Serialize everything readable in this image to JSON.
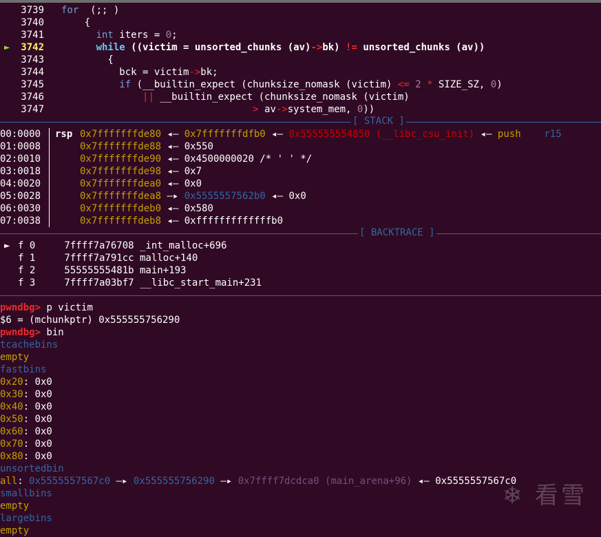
{
  "source": {
    "lines": [
      {
        "num": "3739",
        "parts": [
          [
            "kw",
            "for"
          ],
          [
            "",
            "  (;; )"
          ]
        ]
      },
      {
        "num": "3740",
        "parts": [
          [
            "",
            "    {"
          ]
        ]
      },
      {
        "num": "3741",
        "parts": [
          [
            "",
            "      "
          ],
          [
            "kw",
            "int"
          ],
          [
            "",
            " iters = "
          ],
          [
            "num",
            "0"
          ],
          [
            "",
            ";"
          ]
        ]
      },
      {
        "num": "3742",
        "parts": [
          [
            "",
            "      "
          ],
          [
            "cyanish",
            "while"
          ],
          [
            "",
            " ((victim = unsorted_chunks (av)"
          ],
          [
            "op",
            "->"
          ],
          [
            "",
            "bk) "
          ],
          [
            "op",
            "!="
          ],
          [
            "",
            " unsorted_chunks (av))"
          ]
        ]
      },
      {
        "num": "3743",
        "parts": [
          [
            "",
            "        {"
          ]
        ]
      },
      {
        "num": "3744",
        "parts": [
          [
            "",
            "          bck = victim"
          ],
          [
            "op",
            "->"
          ],
          [
            "",
            "bk;"
          ]
        ]
      },
      {
        "num": "3745",
        "parts": [
          [
            "",
            "          "
          ],
          [
            "kw",
            "if"
          ],
          [
            "",
            " (__builtin_expect (chunksize_nomask (victim) "
          ],
          [
            "op",
            "<="
          ],
          [
            "",
            " "
          ],
          [
            "num",
            "2"
          ],
          [
            "",
            " "
          ],
          [
            "op",
            "*"
          ],
          [
            "",
            " SIZE_SZ, "
          ],
          [
            "num",
            "0"
          ],
          [
            "",
            ")"
          ]
        ]
      },
      {
        "num": "3746",
        "parts": [
          [
            "",
            "              "
          ],
          [
            "op",
            "||"
          ],
          [
            "",
            " __builtin_expect (chunksize_nomask (victim)"
          ]
        ]
      },
      {
        "num": "3747",
        "parts": [
          [
            "",
            "                                 "
          ],
          [
            "op",
            ">"
          ],
          [
            "",
            " av"
          ],
          [
            "op",
            "->"
          ],
          [
            "",
            "system_mem, "
          ],
          [
            "num",
            "0"
          ],
          [
            "",
            "))"
          ]
        ]
      }
    ],
    "current_line_index": 3
  },
  "stack_title": "[ STACK ]",
  "stack": [
    {
      "idx": "00:0000",
      "reg": "rsp",
      "parts": [
        [
          "addr-stack",
          "0x7fffffffde80"
        ],
        [
          "",
          " ◂— "
        ],
        [
          "addr-stack",
          "0x7fffffffdfb0"
        ],
        [
          "",
          " ◂— "
        ],
        [
          "addr-code",
          "0x555555554850 (__libc_csu_init)"
        ],
        [
          "",
          " ◂— "
        ],
        [
          "yellow",
          "push"
        ],
        [
          "",
          "    "
        ],
        [
          "blue",
          "r15"
        ]
      ]
    },
    {
      "idx": "01:0008",
      "reg": "",
      "parts": [
        [
          "addr-stack",
          "0x7fffffffde88"
        ],
        [
          "",
          " ◂— 0x550"
        ]
      ]
    },
    {
      "idx": "02:0010",
      "reg": "",
      "parts": [
        [
          "addr-stack",
          "0x7fffffffde90"
        ],
        [
          "",
          " ◂— 0x4500000020 /* ' ' */"
        ]
      ]
    },
    {
      "idx": "03:0018",
      "reg": "",
      "parts": [
        [
          "addr-stack",
          "0x7fffffffde98"
        ],
        [
          "",
          " ◂— 0x7"
        ]
      ]
    },
    {
      "idx": "04:0020",
      "reg": "",
      "parts": [
        [
          "addr-stack",
          "0x7fffffffdea0"
        ],
        [
          "",
          " ◂— 0x0"
        ]
      ]
    },
    {
      "idx": "05:0028",
      "reg": "",
      "parts": [
        [
          "addr-stack",
          "0x7fffffffdea8"
        ],
        [
          "",
          " —▸ "
        ],
        [
          "addr-heap",
          "0x5555557562b0"
        ],
        [
          "",
          " ◂— 0x0"
        ]
      ]
    },
    {
      "idx": "06:0030",
      "reg": "",
      "parts": [
        [
          "addr-stack",
          "0x7fffffffdeb0"
        ],
        [
          "",
          " ◂— 0x580"
        ]
      ]
    },
    {
      "idx": "07:0038",
      "reg": "",
      "parts": [
        [
          "addr-stack",
          "0x7fffffffdeb8"
        ],
        [
          "",
          " ◂— 0xfffffffffffffb0"
        ]
      ]
    }
  ],
  "backtrace_title": "[ BACKTRACE ]",
  "backtrace": [
    {
      "current": true,
      "text": "f 0     7ffff7a76708 _int_malloc+696"
    },
    {
      "current": false,
      "text": "f 1     7ffff7a791cc malloc+140"
    },
    {
      "current": false,
      "text": "f 2     55555555481b main+193"
    },
    {
      "current": false,
      "text": "f 3     7ffff7a03bf7 __libc_start_main+231"
    }
  ],
  "console": [
    {
      "parts": [
        [
          "redb",
          "pwndbg>"
        ],
        [
          "",
          " p victim"
        ]
      ]
    },
    {
      "parts": [
        [
          "",
          "$6 = (mchunkptr) 0x555555756290"
        ]
      ]
    },
    {
      "parts": [
        [
          "redb",
          "pwndbg>"
        ],
        [
          "",
          " bin"
        ]
      ]
    },
    {
      "parts": [
        [
          "blue",
          "tcachebins"
        ]
      ]
    },
    {
      "parts": [
        [
          "yellow",
          "empty"
        ]
      ]
    },
    {
      "parts": [
        [
          "blue",
          "fastbins"
        ]
      ]
    },
    {
      "parts": [
        [
          "yellow",
          "0x20"
        ],
        [
          "",
          ": 0x0"
        ]
      ]
    },
    {
      "parts": [
        [
          "yellow",
          "0x30"
        ],
        [
          "",
          ": 0x0"
        ]
      ]
    },
    {
      "parts": [
        [
          "yellow",
          "0x40"
        ],
        [
          "",
          ": 0x0"
        ]
      ]
    },
    {
      "parts": [
        [
          "yellow",
          "0x50"
        ],
        [
          "",
          ": 0x0"
        ]
      ]
    },
    {
      "parts": [
        [
          "yellow",
          "0x60"
        ],
        [
          "",
          ": 0x0"
        ]
      ]
    },
    {
      "parts": [
        [
          "yellow",
          "0x70"
        ],
        [
          "",
          ": 0x0"
        ]
      ]
    },
    {
      "parts": [
        [
          "yellow",
          "0x80"
        ],
        [
          "",
          ": 0x0"
        ]
      ]
    },
    {
      "parts": [
        [
          "blue",
          "unsortedbin"
        ]
      ]
    },
    {
      "parts": [
        [
          "yellow",
          "all"
        ],
        [
          "",
          ": "
        ],
        [
          "addr-heap",
          "0x5555557567c0"
        ],
        [
          "",
          " —▸ "
        ],
        [
          "addr-heap",
          "0x555555756290"
        ],
        [
          "",
          " —▸ "
        ],
        [
          "addr-lib",
          "0x7ffff7dcdca0 (main_arena+96)"
        ],
        [
          "",
          " ◂— 0x5555557567c0"
        ]
      ]
    },
    {
      "parts": [
        [
          "blue",
          "smallbins"
        ]
      ]
    },
    {
      "parts": [
        [
          "yellow",
          "empty"
        ]
      ]
    },
    {
      "parts": [
        [
          "blue",
          "largebins"
        ]
      ]
    },
    {
      "parts": [
        [
          "yellow",
          "empty"
        ]
      ]
    }
  ],
  "watermark": {
    "text": "看雪",
    "icon": "snowflake-icon"
  }
}
